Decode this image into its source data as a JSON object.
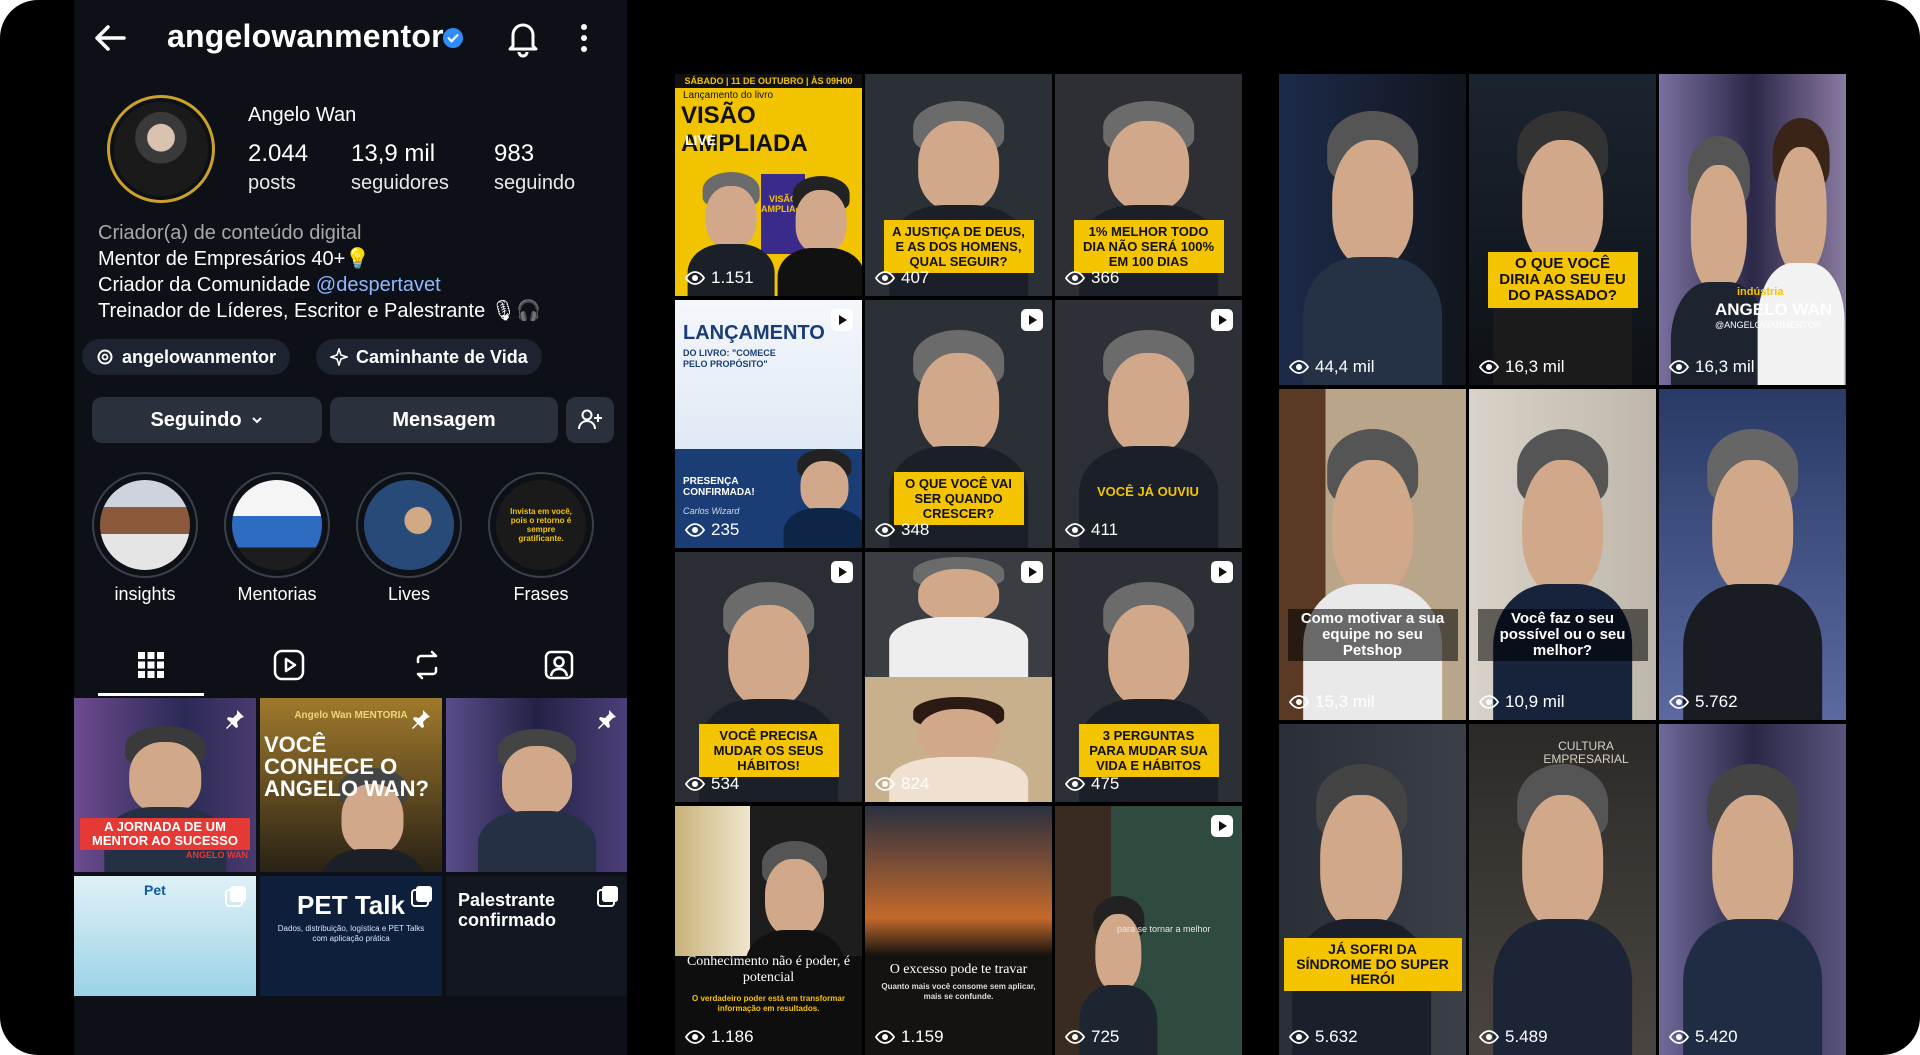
{
  "profile": {
    "handle": "angelowanmentor",
    "name": "Angelo Wan",
    "stats": [
      {
        "num": "2.044",
        "label": "posts"
      },
      {
        "num": "13,9 mil",
        "label": "seguidores"
      },
      {
        "num": "983",
        "label": "seguindo"
      }
    ],
    "bio": {
      "category": "Criador(a) de conteúdo digital",
      "line1": "Mentor de Empresários 40+💡",
      "line2_prefix": "Criador da Comunidade ",
      "line2_mention": "@despertavet",
      "line3": "Treinador de Líderes, Escritor e Palestrante 🎙🎧"
    },
    "chips": [
      "angelowanmentor",
      "Caminhante de Vida"
    ],
    "buttons": {
      "following": "Seguindo",
      "message": "Mensagem"
    },
    "highlights": [
      {
        "label": "insights"
      },
      {
        "label": "Mentorias"
      },
      {
        "label": "Lives"
      },
      {
        "label": "Frases",
        "text": "Invista em você, pois o retorno é sempre gratificante."
      }
    ],
    "tabs": [
      "grid-icon",
      "reels-icon",
      "reposts-icon",
      "tagged-icon"
    ],
    "posts": [
      {
        "caption": "A JORNADA DE UM MENTOR AO SUCESSO",
        "subtitle": "ANGELO WAN"
      },
      {
        "caption": "VOCÊ CONHECE O ANGELO WAN?",
        "brand": "Angelo Wan MENTORIA"
      },
      {
        "caption": ""
      },
      {
        "caption": "Pet"
      },
      {
        "caption": "PET Talk",
        "subtitle": "Dados, distribuição, logística e PET Talks com aplicação prática"
      },
      {
        "caption": "Palestrante confirmado"
      }
    ]
  },
  "grid_a": [
    {
      "views": "1.151",
      "title": "VISÃO AMPLIADA",
      "top": "SÁBADO | 11 DE OUTUBRO | ÀS 09H00",
      "sub": "Lançamento do livro",
      "live": "LIVE",
      "book": "VISÃO AMPLIADA"
    },
    {
      "views": "407",
      "caption": "A JUSTIÇA DE DEUS, E AS DOS HOMENS, QUAL SEGUIR?"
    },
    {
      "views": "366",
      "caption": "1% MELHOR TODO DIA NÃO SERÁ 100% EM 100 DIAS"
    },
    {
      "views": "235",
      "title": "LANÇAMENTO",
      "sub": "DO LIVRO: \"COMECE PELO PROPÓSITO\"",
      "badge": "PRESENÇA CONFIRMADA!",
      "guest": "Carlos Wizard"
    },
    {
      "views": "348",
      "caption": "O QUE VOCÊ VAI SER QUANDO CRESCER?"
    },
    {
      "views": "411",
      "caption": "VOCÊ JÁ OUVIU"
    },
    {
      "views": "534",
      "caption": "VOCÊ PRECISA MUDAR OS SEUS HÁBITOS!"
    },
    {
      "views": "824",
      "caption": ""
    },
    {
      "views": "475",
      "caption": "3 PERGUNTAS PARA MUDAR SUA VIDA E HÁBITOS"
    },
    {
      "views": "1.186",
      "caption": "Conhecimento não é poder, é potencial",
      "sub": "O verdadeiro poder está em transformar informação em resultados."
    },
    {
      "views": "1.159",
      "caption": "O excesso pode te travar",
      "sub": "Quanto mais você consome sem aplicar, mais se confunde."
    },
    {
      "views": "725",
      "caption": "para se tornar a melhor"
    }
  ],
  "grid_b": [
    {
      "views": "44,4 mil",
      "caption": ""
    },
    {
      "views": "16,3 mil",
      "caption": "O QUE VOCÊ DIRIA AO SEU EU DO PASSADO?"
    },
    {
      "views": "16,3 mil",
      "caption": "ANGELO WAN",
      "sub": "@ANGELOWANMENTOR",
      "tag": "indústria"
    },
    {
      "views": "15,3 mil",
      "caption": "Como motivar a sua equipe no seu Petshop"
    },
    {
      "views": "10,9 mil",
      "caption": "Você faz o seu possível ou o seu melhor?"
    },
    {
      "views": "5.762",
      "caption": ""
    },
    {
      "views": "5.632",
      "caption": "JÁ SOFRI DA SÍNDROME DO SUPER HERÓI"
    },
    {
      "views": "5.489",
      "caption": "CULTURA EMPRESARIAL"
    },
    {
      "views": "5.420",
      "caption": ""
    }
  ],
  "colors": {
    "accent_yellow": "#f5c400",
    "verified_blue": "#2f8cff",
    "panel_bg": "#0d1117"
  }
}
